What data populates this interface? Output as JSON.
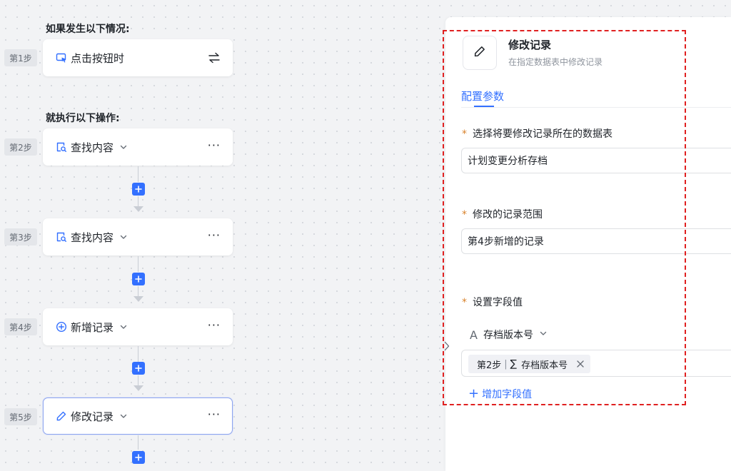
{
  "canvas": {
    "trigger_heading": "如果发生以下情况:",
    "action_heading": "就执行以下操作:",
    "steps": [
      {
        "tag": "第1步",
        "label": "点击按钮时",
        "icon": "cursor-click-icon",
        "trailing": "swap-icon"
      },
      {
        "tag": "第2步",
        "label": "查找内容",
        "icon": "find-doc-icon",
        "trailing": "more-icon"
      },
      {
        "tag": "第3步",
        "label": "查找内容",
        "icon": "find-doc-icon",
        "trailing": "more-icon"
      },
      {
        "tag": "第4步",
        "label": "新增记录",
        "icon": "plus-circle-icon",
        "trailing": "more-icon"
      },
      {
        "tag": "第5步",
        "label": "修改记录",
        "icon": "pencil-icon",
        "trailing": "more-icon"
      }
    ],
    "more_glyph": "···",
    "add_glyph": "+"
  },
  "panel": {
    "title": "修改记录",
    "subtitle": "在指定数据表中修改记录",
    "tab": "配置参数",
    "required_mark": "*",
    "fields": [
      {
        "label": "选择将要修改记录所在的数据表",
        "value": "计划变更分析存档"
      },
      {
        "label": "修改的记录范围",
        "value": "第4步新增的记录"
      }
    ],
    "set_values": {
      "label": "设置字段值",
      "field_type_glyph": "A",
      "field_name": "存档版本号",
      "chip": {
        "step": "第2步",
        "separator": "|",
        "sigma": "∑",
        "field": "存档版本号"
      },
      "add_label": "增加字段值",
      "add_glyph": "+"
    }
  },
  "colors": {
    "accent": "#3370ff",
    "required": "#d9822b",
    "highlight": "#e02020"
  }
}
